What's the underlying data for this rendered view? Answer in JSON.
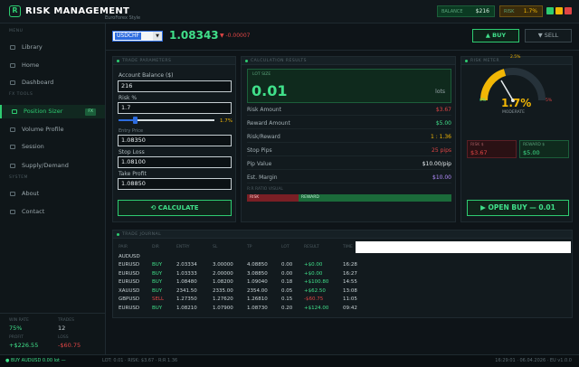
{
  "app": {
    "title": "RISK MANAGEMENT",
    "subtitle": "EuroForex Style",
    "balance_label": "BALANCE",
    "balance_value": "$216",
    "risk_label": "RISK",
    "risk_value": "1.7%"
  },
  "sidebar": {
    "section_main": "MENU",
    "section_tools": "FX TOOLS",
    "section_system": "SYSTEM",
    "items": [
      {
        "label": "Library"
      },
      {
        "label": "Home"
      },
      {
        "label": "Dashboard"
      },
      {
        "label": "Position Sizer",
        "badge": "FX"
      },
      {
        "label": "Volume Profile"
      },
      {
        "label": "Session"
      },
      {
        "label": "Supply/Demand"
      },
      {
        "label": "About"
      },
      {
        "label": "Contact"
      }
    ],
    "stats": {
      "winrate_label": "WIN RATE",
      "winrate_value": "75%",
      "trades_label": "TRADES",
      "trades_value": "12",
      "profit_label": "PROFIT",
      "profit_value": "+$226.55",
      "loss_label": "LOSS",
      "loss_value": "-$60.75"
    }
  },
  "toolbar": {
    "symbol": "USDCHF",
    "price": "1.08343",
    "change": "▼ -0.00007",
    "buy_label": "▲ BUY",
    "sell_label": "▼ SELL"
  },
  "params": {
    "header": "TRADE PARAMETERS",
    "account_balance_label": "Account Balance ($)",
    "account_balance_value": "216",
    "risk_pct_label": "Risk %",
    "risk_pct_value": "1.7",
    "risk_slider_display": "1.7%",
    "risk_slider_fraction": 0.17,
    "entry_label": "Entry Price",
    "entry_value": "1.08350",
    "stoploss_label": "Stop Loss",
    "stoploss_value": "1.08100",
    "takeprofit_label": "Take Profit",
    "takeprofit_value": "1.08850",
    "calculate_label": "CALCULATE"
  },
  "results": {
    "header": "CALCULATION RESULTS",
    "lot_label": "LOT SIZE",
    "lot_value": "0.01",
    "lot_unit": "lots",
    "rows": [
      {
        "label": "Risk Amount",
        "value": "$3.67",
        "color": "#e04545"
      },
      {
        "label": "Reward Amount",
        "value": "$5.00",
        "color": "#40e08a"
      },
      {
        "label": "Risk/Reward",
        "value": "1 : 1.36",
        "color": "#f2b705"
      },
      {
        "label": "Stop Pips",
        "value": "25 pips",
        "color": "#e04545"
      },
      {
        "label": "Pip Value",
        "value": "$10.00/pip",
        "color": "#e8eef0"
      },
      {
        "label": "Est. Margin",
        "value": "$10.00",
        "color": "#b48cff"
      }
    ],
    "rr_label": "R:R RATIO VISUAL",
    "rr_risk_label": "RISK",
    "rr_reward_label": "REWARD",
    "rr_risk_fraction": 0.25
  },
  "risk_meter": {
    "header": "RISK METER",
    "top_label": "2.5%",
    "min_label": "0%",
    "max_label": "5%",
    "value": "1.7%",
    "status": "MODERATE",
    "risk_box_label": "RISK $",
    "risk_box_value": "$3.67",
    "reward_box_label": "REWARD $",
    "reward_box_value": "$5.00",
    "open_label": "OPEN BUY — 0.01"
  },
  "trades": {
    "header": "TRADE JOURNAL",
    "columns": [
      "PAIR",
      "DIR",
      "ENTRY",
      "SL",
      "TP",
      "LOT",
      "RESULT",
      "TIME"
    ],
    "group": "AUDUSD",
    "rows": [
      {
        "pair": "EURUSD",
        "dir": "BUY",
        "entry": "2.03334",
        "sl": "3.00000",
        "tp": "4.08850",
        "lot": "0.00",
        "result": "+$0.00",
        "time": "16:28"
      },
      {
        "pair": "EURUSD",
        "dir": "BUY",
        "entry": "1.03333",
        "sl": "2.00000",
        "tp": "3.08850",
        "lot": "0.00",
        "result": "+$0.00",
        "time": "16:27"
      },
      {
        "pair": "EURUSD",
        "dir": "BUY",
        "entry": "1.08480",
        "sl": "1.08200",
        "tp": "1.09040",
        "lot": "0.18",
        "result": "+$100.80",
        "time": "14:55"
      },
      {
        "pair": "XAUUSD",
        "dir": "BUY",
        "entry": "2341.50",
        "sl": "2335.00",
        "tp": "2354.00",
        "lot": "0.05",
        "result": "+$62.50",
        "time": "13:08"
      },
      {
        "pair": "GBPUSD",
        "dir": "SELL",
        "entry": "1.27350",
        "sl": "1.27620",
        "tp": "1.26810",
        "lot": "0.15",
        "result": "-$60.75",
        "time": "11:05"
      },
      {
        "pair": "EURUSD",
        "dir": "BUY",
        "entry": "1.08210",
        "sl": "1.07900",
        "tp": "1.08730",
        "lot": "0.20",
        "result": "+$124.00",
        "time": "09:42"
      }
    ]
  },
  "status": {
    "left": "● BUY AUDUSD 0.00 lot —",
    "mid": "LOT: 0.01 · RISK: $3.67 · R:R 1.36",
    "right": "16:29:01 · 06.04.2026 · EU v1.0.0"
  }
}
